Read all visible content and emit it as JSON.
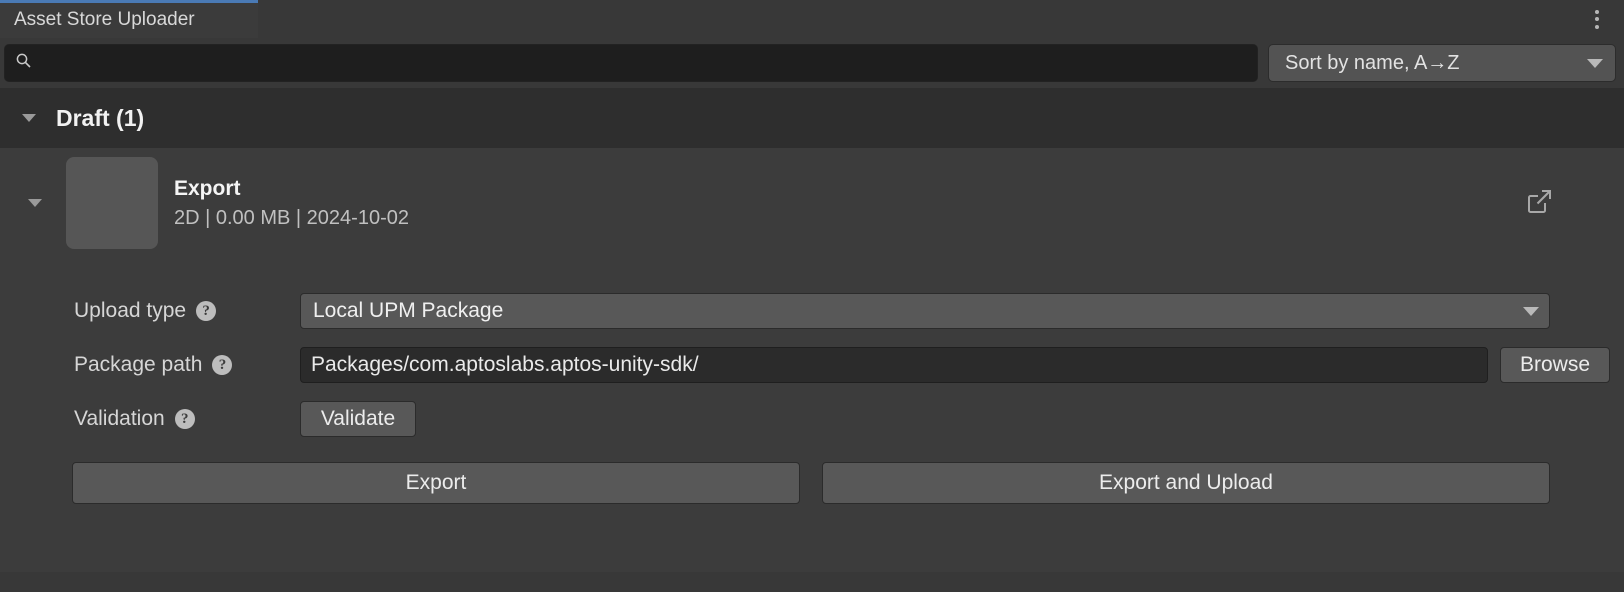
{
  "window": {
    "tab_label": "Asset Store Uploader",
    "menu_icon": "kebab-menu-icon"
  },
  "toolbar": {
    "search_value": "",
    "search_placeholder": "",
    "search_icon": "search-icon",
    "sort_label": "Sort by name, A→Z",
    "sort_caret_icon": "chevron-down-icon"
  },
  "section": {
    "foldout_icon": "triangle-down-icon",
    "title": "Draft (1)"
  },
  "package": {
    "foldout_icon": "triangle-down-icon",
    "thumbnail": "package-thumbnail-placeholder",
    "name": "Export",
    "meta": "2D | 0.00 MB | 2024-10-02",
    "open_icon": "external-link-icon"
  },
  "form": {
    "upload_type": {
      "label": "Upload type",
      "help_icon": "help-icon",
      "value": "Local UPM Package",
      "caret_icon": "chevron-down-icon"
    },
    "package_path": {
      "label": "Package path",
      "help_icon": "help-icon",
      "value": "Packages/com.aptoslabs.aptos-unity-sdk/",
      "placeholder": "",
      "browse_label": "Browse"
    },
    "validation": {
      "label": "Validation",
      "help_icon": "help-icon",
      "button_label": "Validate"
    }
  },
  "actions": {
    "export_label": "Export",
    "export_upload_label": "Export and Upload"
  },
  "colors": {
    "tab_accent": "#4a7ab5",
    "window_bg": "#383838",
    "section_bg": "#2e2e2e",
    "body_bg": "#3c3c3c"
  }
}
